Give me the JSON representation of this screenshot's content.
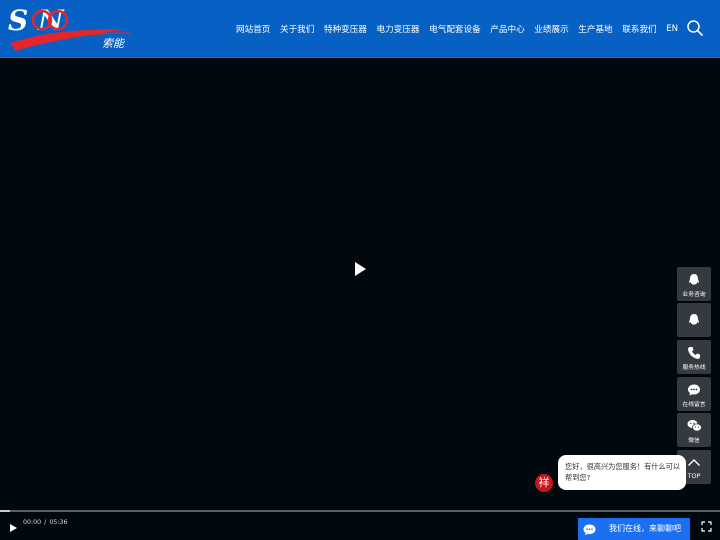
{
  "header": {
    "logo_text": "S    N",
    "logo_subtext": "索能",
    "nav": [
      "网站首页",
      "关于我们",
      "特种变压器",
      "电力变压器",
      "电气配套设备",
      "产品中心",
      "业绩展示",
      "生产基地",
      "联系我们",
      "EN"
    ],
    "search_icon": "search-icon"
  },
  "video": {
    "current_time": "00:00",
    "separator": "/",
    "duration": "05:36",
    "progress_fraction": 0.0
  },
  "sidebar": {
    "items": [
      {
        "label": "业务咨询",
        "icon": "qq-icon"
      },
      {
        "label": "",
        "icon": "qq-icon"
      },
      {
        "label": "服务热线",
        "icon": "phone-icon"
      },
      {
        "label": "在线留言",
        "icon": "chat-icon"
      },
      {
        "label": "微信",
        "icon": "wechat-icon"
      },
      {
        "label": "TOP",
        "icon": "chevron-up-icon"
      }
    ]
  },
  "chat": {
    "bubble_text": "您好，很高兴为您服务！有什么可以帮到您?",
    "seal_char": "祥",
    "bar_label": "我们在线，来聊聊吧"
  },
  "colors": {
    "header_bg": "#0760c3",
    "page_bg": "#01080e",
    "sidebar_bg": "#353a40",
    "chat_bar_bg": "#1d6ff2",
    "seal_red": "#c4161c"
  }
}
